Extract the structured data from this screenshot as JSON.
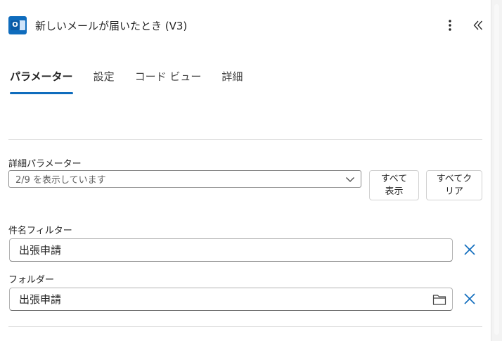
{
  "header": {
    "title": "新しいメールが届いたとき (V3)",
    "app_icon": "outlook-icon",
    "more_icon": "more-vertical-icon",
    "collapse_icon": "double-chevron-left-icon"
  },
  "tabs": [
    {
      "label": "パラメーター",
      "active": true
    },
    {
      "label": "設定",
      "active": false
    },
    {
      "label": "コード ビュー",
      "active": false
    },
    {
      "label": "詳細",
      "active": false
    }
  ],
  "advanced": {
    "label": "詳細パラメーター",
    "select_value": "2/9 を表示しています",
    "show_all_label_line1": "すべて",
    "show_all_label_line2": "表示",
    "clear_all_label_line1": "すべてク",
    "clear_all_label_line2": "リア"
  },
  "fields": {
    "subject_filter": {
      "label": "件名フィルター",
      "value": "出張申請"
    },
    "folder": {
      "label": "フォルダー",
      "value": "出張申請"
    }
  },
  "colors": {
    "accent": "#0f6cbd"
  }
}
